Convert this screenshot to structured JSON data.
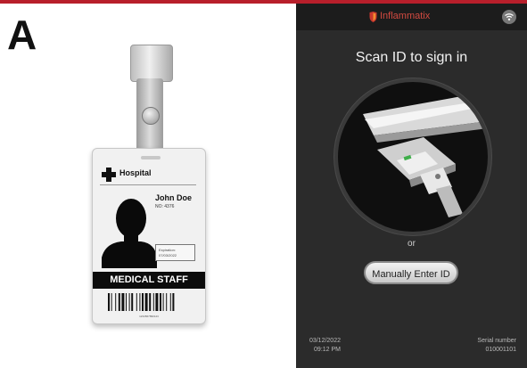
{
  "panel_label": "A",
  "colors": {
    "accent_red": "#b81f2b",
    "device_bg": "#2b2b2b",
    "brand": "#d24a40"
  },
  "badge": {
    "facility": "Hospital",
    "facility_icon": "medical-cross-icon",
    "name": "John Doe",
    "number": "NO: 4376",
    "expiration_label": "Expiration:",
    "expiration_date": "07/03/2022",
    "role": "MEDICAL STAFF",
    "barcode_number": "1234567890123"
  },
  "device": {
    "brand": "Inflammatix",
    "brand_icon": "shield-logo-icon",
    "wifi_icon": "wifi-icon",
    "title": "Scan ID to sign in",
    "or_text": "or",
    "manual_button": "Manually Enter ID",
    "date": "03/12/2022",
    "time": "09:12 PM",
    "serial_label": "Serial number",
    "serial_number": "010001101"
  }
}
